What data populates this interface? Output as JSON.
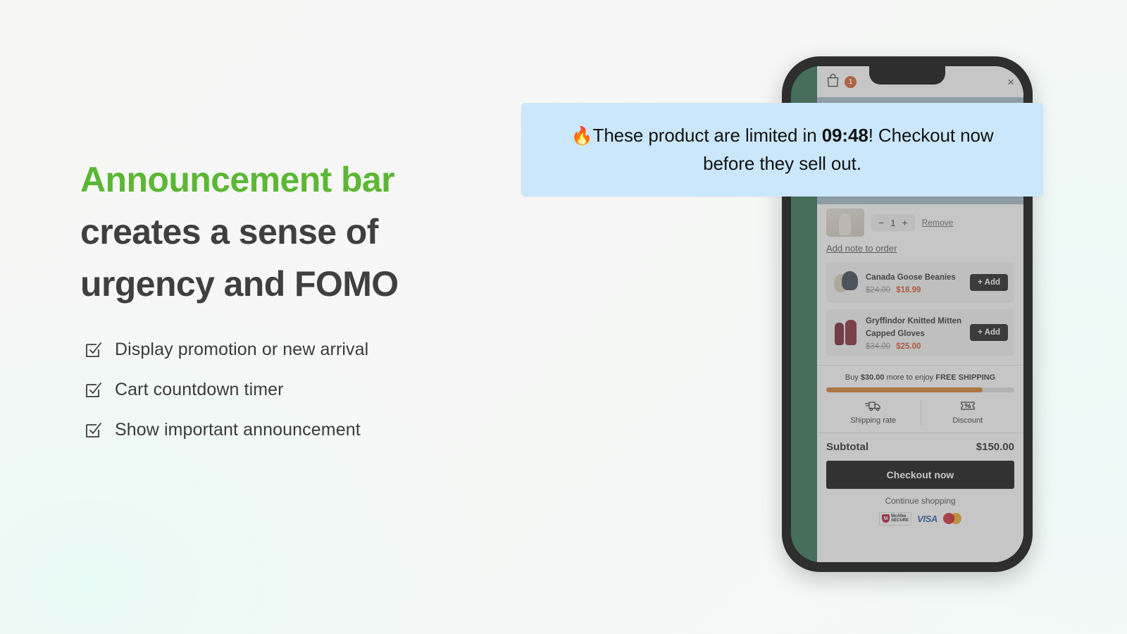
{
  "colors": {
    "accent_green": "#5cb734",
    "heading_dark": "#3d3d3d",
    "banner_blue": "#cbe7fb",
    "sale_red": "#d8461c",
    "progress_orange": "#d0761f",
    "badge_orange": "#d4551f",
    "phone_frame": "#2e2e2e",
    "store_green": "#236848",
    "page_bg": "#f7f7f6"
  },
  "headline": {
    "line1": "Announcement bar",
    "line2": "creates a sense of",
    "line3": "urgency and FOMO"
  },
  "features": [
    {
      "icon": "checkbox-checked-icon",
      "label": "Display promotion or new arrival"
    },
    {
      "icon": "checkbox-checked-icon",
      "label": "Cart countdown timer"
    },
    {
      "icon": "checkbox-checked-icon",
      "label": "Show important announcement"
    }
  ],
  "announcement": {
    "flame_icon": "🔥",
    "text_before": "These product are limited in ",
    "timer": "09:48",
    "text_after": "! Checkout now before they sell out."
  },
  "phone": {
    "cart_header": {
      "bag_icon": "shopping-bag-icon",
      "item_count": "1",
      "close_icon": "×"
    },
    "cart_item": {
      "thumbnail": "product-thumbnail",
      "decrement": "−",
      "quantity": "1",
      "increment": "+",
      "remove_label": "Remove"
    },
    "note_link": "Add note to order",
    "recommendations": [
      {
        "thumbnail": "beanie-thumbnail",
        "title": "Canada Goose Beanies",
        "price_old": "$24.00",
        "price_new": "$18.99",
        "add_label": "+ Add"
      },
      {
        "thumbnail": "gloves-thumbnail",
        "title": "Gryffindor Knitted Mitten Capped Gloves",
        "price_old": "$34.00",
        "price_new": "$25.00",
        "add_label": "+ Add"
      }
    ],
    "free_shipping": {
      "prefix": "Buy ",
      "amount": "$30.00",
      "middle": " more to enjoy ",
      "highlight": "FREE SHIPPING",
      "progress_percent": "83"
    },
    "utility": [
      {
        "icon": "truck-icon",
        "label": "Shipping rate"
      },
      {
        "icon": "discount-tag-icon",
        "label": "Discount"
      }
    ],
    "totals": {
      "subtotal_label": "Subtotal",
      "subtotal_value": "$150.00"
    },
    "checkout_label": "Checkout now",
    "continue_label": "Continue shopping",
    "payment_badges": [
      {
        "name": "mcafee-secure-badge",
        "line1": "McAfee",
        "line2": "SECURE",
        "mark": "M"
      },
      {
        "name": "visa-badge",
        "label": "VISA"
      },
      {
        "name": "mastercard-badge",
        "label": ""
      }
    ]
  }
}
